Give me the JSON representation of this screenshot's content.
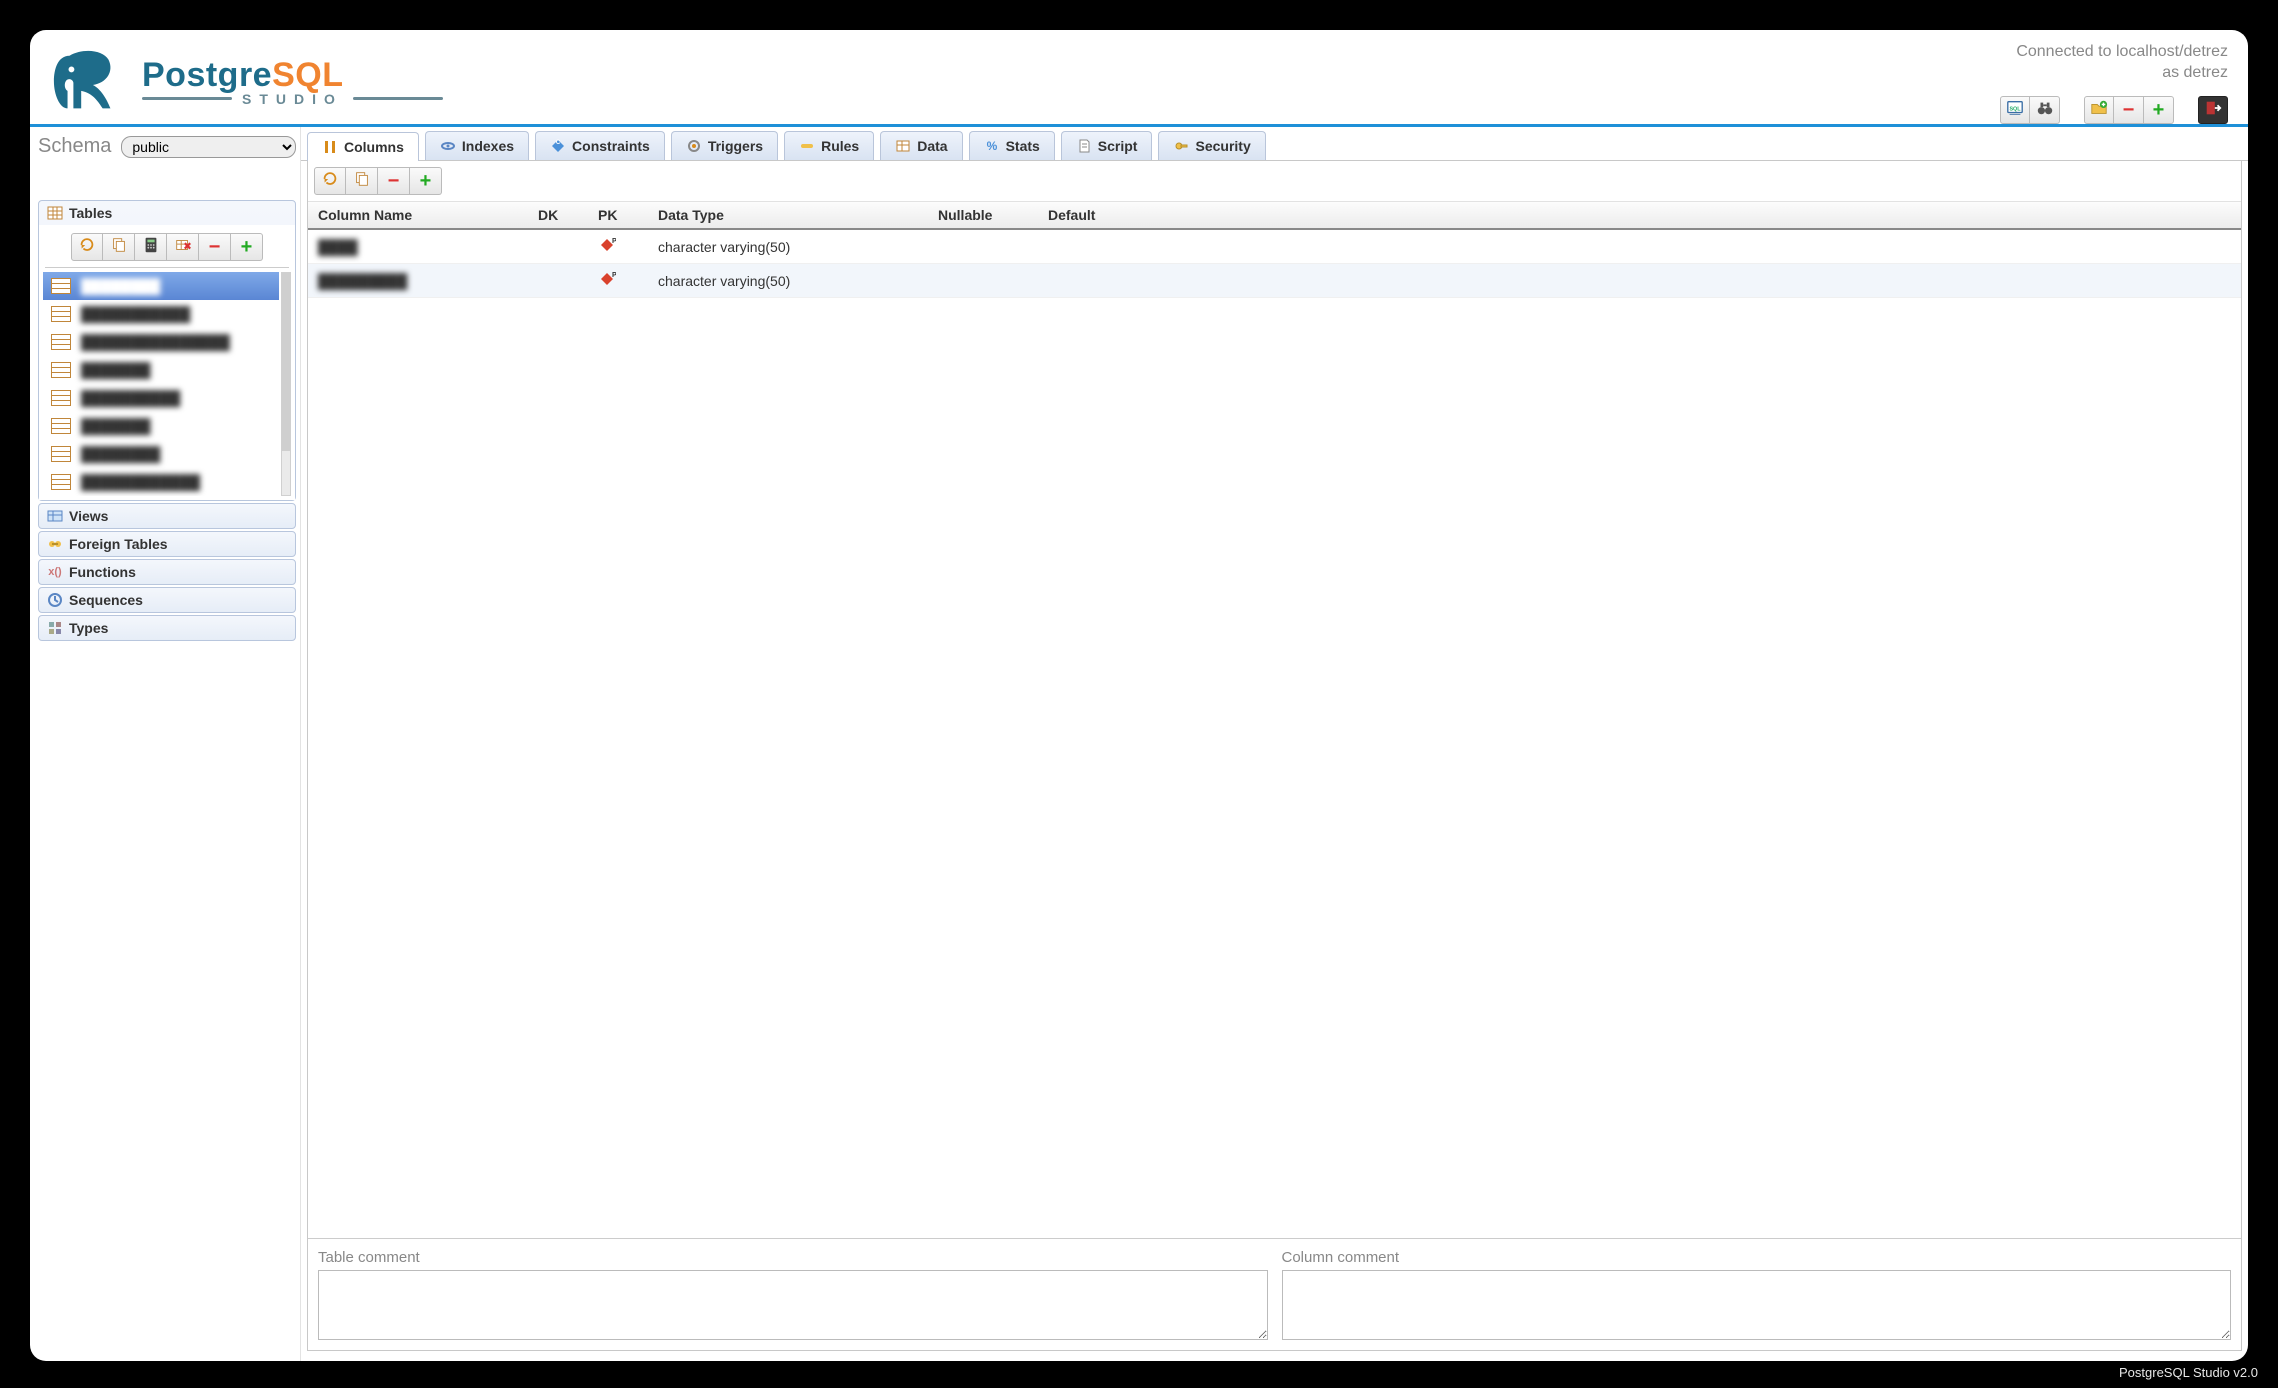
{
  "app": {
    "connection_line1": "Connected to localhost/detrez",
    "connection_line2": "as detrez",
    "footer": "PostgreSQL Studio v2.0"
  },
  "logo": {
    "name_pre": "Postgre",
    "name_sql": "SQL",
    "sub": "STUDIO"
  },
  "top_toolbar": {
    "group1": [
      {
        "name": "sql-editor-button",
        "icon": "sql-icon"
      },
      {
        "name": "search-button",
        "icon": "binoculars-icon"
      }
    ],
    "group2": [
      {
        "name": "new-connection-button",
        "icon": "folder-plus-icon"
      },
      {
        "name": "remove-connection-button",
        "icon": "minus-icon"
      },
      {
        "name": "add-connection-button",
        "icon": "plus-icon"
      }
    ],
    "group3": [
      {
        "name": "logout-button",
        "icon": "exit-icon"
      }
    ]
  },
  "schema": {
    "label": "Schema",
    "selected": "public",
    "options": [
      "public"
    ]
  },
  "sidebar": {
    "tables_header": "Tables",
    "tables_toolbar": [
      {
        "name": "refresh-tables-button",
        "icon": "refresh-icon"
      },
      {
        "name": "copy-table-button",
        "icon": "copy-icon"
      },
      {
        "name": "analyze-table-button",
        "icon": "calc-icon"
      },
      {
        "name": "drop-table-button",
        "icon": "drop-icon"
      },
      {
        "name": "remove-table-button",
        "icon": "minus-icon"
      },
      {
        "name": "add-table-button",
        "icon": "plus-icon"
      }
    ],
    "tables": [
      {
        "label": "████████",
        "selected": true
      },
      {
        "label": "███████████",
        "selected": false
      },
      {
        "label": "███████████████",
        "selected": false
      },
      {
        "label": "███████",
        "selected": false
      },
      {
        "label": "██████████",
        "selected": false
      },
      {
        "label": "███████",
        "selected": false
      },
      {
        "label": "████████",
        "selected": false
      },
      {
        "label": "████████████",
        "selected": false
      }
    ],
    "views_header": "Views",
    "foreign_tables_header": "Foreign Tables",
    "functions_header": "Functions",
    "sequences_header": "Sequences",
    "types_header": "Types"
  },
  "tabs": [
    {
      "id": "columns",
      "label": "Columns",
      "active": true
    },
    {
      "id": "indexes",
      "label": "Indexes",
      "active": false
    },
    {
      "id": "constraints",
      "label": "Constraints",
      "active": false
    },
    {
      "id": "triggers",
      "label": "Triggers",
      "active": false
    },
    {
      "id": "rules",
      "label": "Rules",
      "active": false
    },
    {
      "id": "data",
      "label": "Data",
      "active": false
    },
    {
      "id": "stats",
      "label": "Stats",
      "active": false
    },
    {
      "id": "script",
      "label": "Script",
      "active": false
    },
    {
      "id": "security",
      "label": "Security",
      "active": false
    }
  ],
  "columns_toolbar": [
    {
      "name": "refresh-columns-button",
      "icon": "refresh-icon"
    },
    {
      "name": "copy-column-button",
      "icon": "copy-icon"
    },
    {
      "name": "remove-column-button",
      "icon": "minus-icon"
    },
    {
      "name": "add-column-button",
      "icon": "plus-icon"
    }
  ],
  "columns_grid": {
    "headers": {
      "name": "Column Name",
      "dk": "DK",
      "pk": "PK",
      "datatype": "Data Type",
      "nullable": "Nullable",
      "default": "Default"
    },
    "rows": [
      {
        "name": "████",
        "dk": "",
        "pk": true,
        "datatype": "character varying(50)",
        "nullable": "",
        "default": ""
      },
      {
        "name": "█████████",
        "dk": "",
        "pk": true,
        "datatype": "character varying(50)",
        "nullable": "",
        "default": ""
      }
    ]
  },
  "comments": {
    "table_label": "Table comment",
    "column_label": "Column comment",
    "table_value": "",
    "column_value": ""
  }
}
